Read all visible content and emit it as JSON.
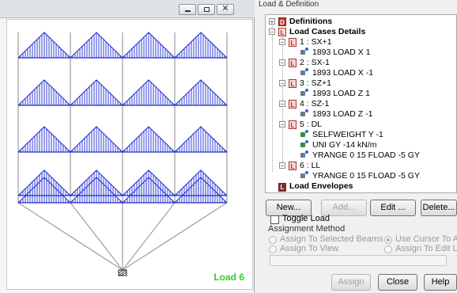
{
  "viewport": {
    "label": "Load 6",
    "window_buttons": [
      "minimize",
      "restore",
      "close"
    ],
    "load_color": "#1f2bd6"
  },
  "dialog": {
    "title": "Load & Definition",
    "tree": {
      "definitions": "Definitions",
      "load_cases": "Load Cases Details",
      "cases": [
        {
          "label": "1 : SX+1",
          "items": [
            "1893 LOAD X 1"
          ]
        },
        {
          "label": "2 : SX-1",
          "items": [
            "1893 LOAD X -1"
          ]
        },
        {
          "label": "3 : SZ+1",
          "items": [
            "1893 LOAD Z 1"
          ]
        },
        {
          "label": "4 : SZ-1",
          "items": [
            "1893 LOAD Z -1"
          ]
        },
        {
          "label": "5 : DL",
          "items": [
            "SELFWEIGHT Y -1",
            "UNI GY -14 kN/m",
            "YRANGE 0 15 FLOAD -5 GY"
          ]
        },
        {
          "label": "6 : LL",
          "items": [
            "YRANGE 0 15 FLOAD -5 GY"
          ]
        }
      ],
      "envelopes": "Load Envelopes"
    },
    "buttons": {
      "new": "New...",
      "add": "Add...",
      "edit": "Edit ...",
      "delete": "Delete..."
    },
    "toggle_load": "Toggle Load",
    "assignment_method": "Assignment Method",
    "radios": {
      "selected_beams": "Assign To Selected Beams",
      "use_cursor": "Use Cursor To Assign",
      "to_view": "Assign To View",
      "edit_list": "Assign To Edit List"
    },
    "bottom_buttons": {
      "assign": "Assign",
      "close": "Close",
      "help": "Help"
    }
  }
}
